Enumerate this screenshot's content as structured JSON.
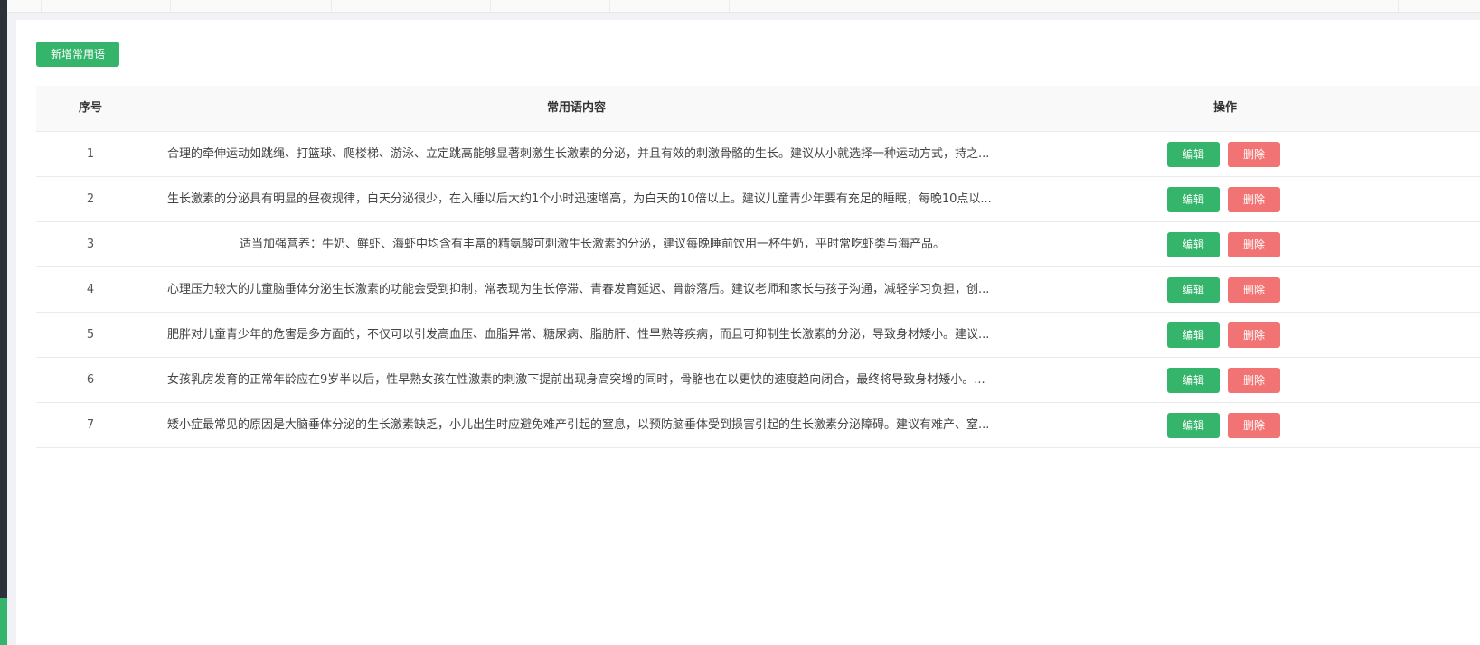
{
  "toolbar": {
    "add_label": "新增常用语"
  },
  "table": {
    "headers": {
      "index": "序号",
      "content": "常用语内容",
      "actions": "操作"
    },
    "rows": [
      {
        "index": "1",
        "content": "合理的牵伸运动如跳绳、打篮球、爬楼梯、游泳、立定跳高能够显著刺激生长激素的分泌，并且有效的刺激骨骼的生长。建议从小就选择一种运动方式，持之...",
        "align": "left"
      },
      {
        "index": "2",
        "content": "生长激素的分泌具有明显的昼夜规律，白天分泌很少，在入睡以后大约1个小时迅速增高，为白天的10倍以上。建议儿童青少年要有充足的睡眠，每晚10点以...",
        "align": "left"
      },
      {
        "index": "3",
        "content": "适当加强营养：牛奶、鲜虾、海虾中均含有丰富的精氨酸可刺激生长激素的分泌，建议每晚睡前饮用一杯牛奶，平时常吃虾类与海产品。",
        "align": "center"
      },
      {
        "index": "4",
        "content": "心理压力较大的儿童脑垂体分泌生长激素的功能会受到抑制，常表现为生长停滞、青春发育延迟、骨龄落后。建议老师和家长与孩子沟通，减轻学习负担，创...",
        "align": "left"
      },
      {
        "index": "5",
        "content": "肥胖对儿童青少年的危害是多方面的，不仅可以引发高血压、血脂异常、糖尿病、脂肪肝、性早熟等疾病，而且可抑制生长激素的分泌，导致身材矮小。建议...",
        "align": "left"
      },
      {
        "index": "6",
        "content": "女孩乳房发育的正常年龄应在9岁半以后，性早熟女孩在性激素的刺激下提前出现身高突增的同时，骨骼也在以更快的速度趋向闭合，最终将导致身材矮小。...",
        "align": "left"
      },
      {
        "index": "7",
        "content": "矮小症最常见的原因是大脑垂体分泌的生长激素缺乏，小儿出生时应避免难产引起的窒息，以预防脑垂体受到损害引起的生长激素分泌障碍。建议有难产、窒...",
        "align": "left"
      }
    ],
    "edit_label": "编辑",
    "delete_label": "删除"
  },
  "colors": {
    "primary": "#35b56b",
    "danger": "#f27373",
    "sidebar": "#2d3139"
  }
}
